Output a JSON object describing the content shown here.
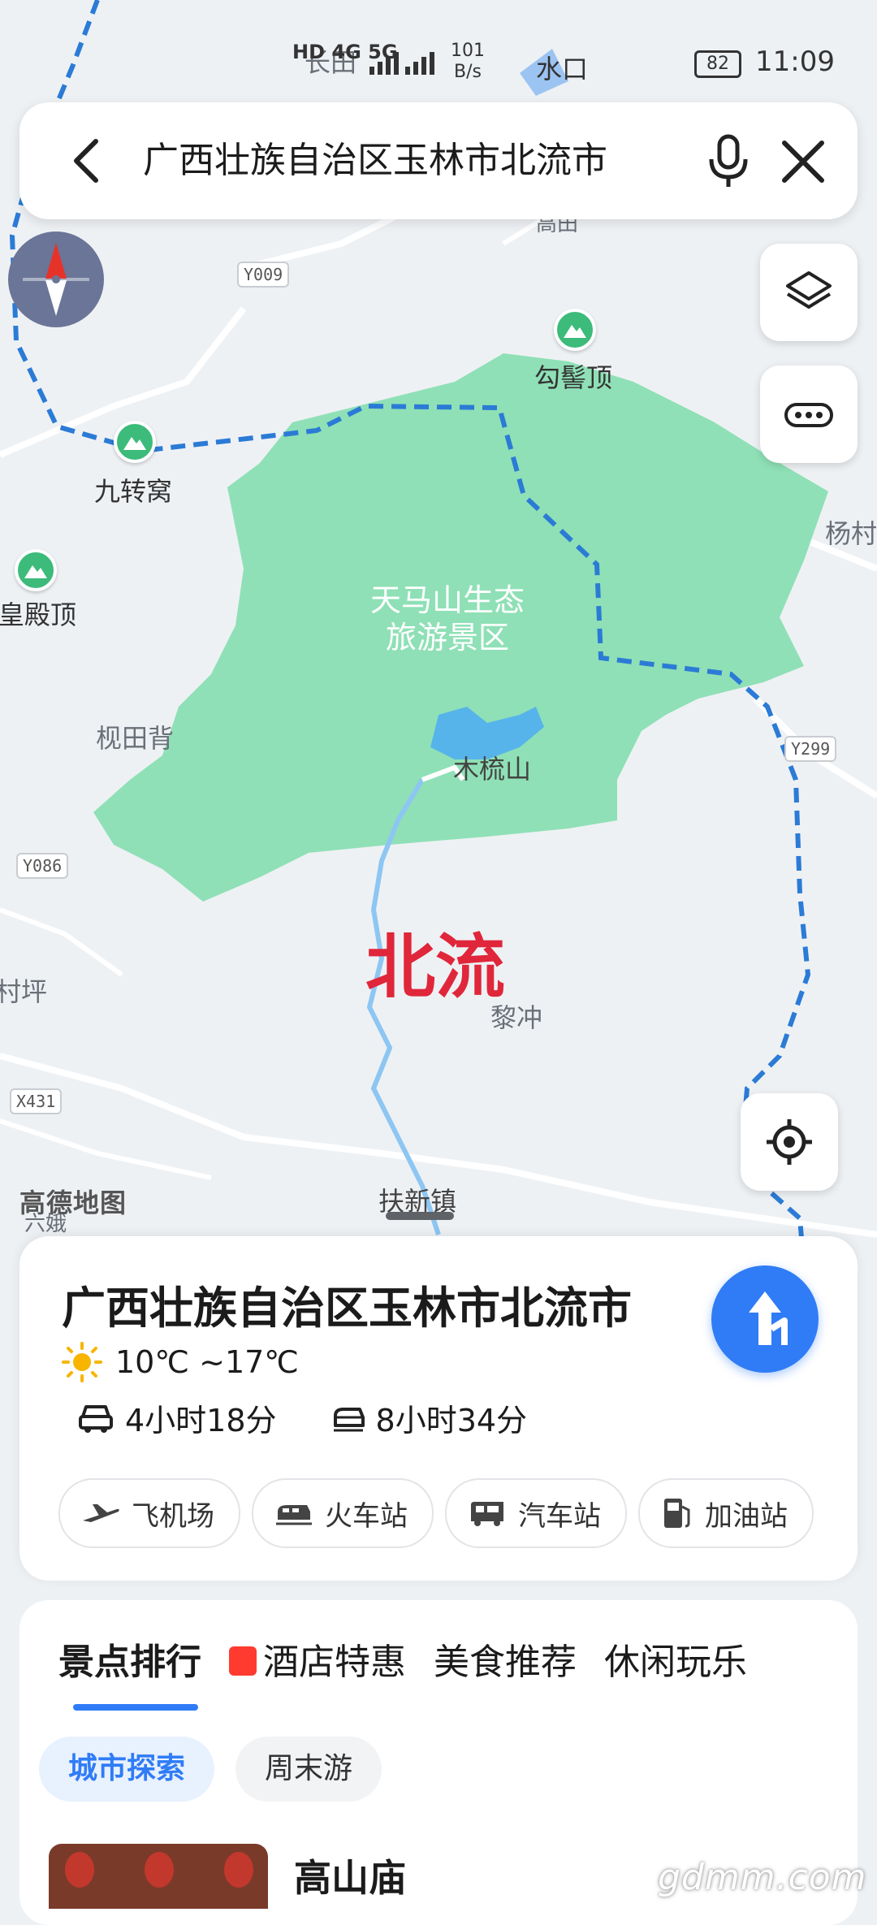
{
  "status_bar": {
    "network": "HD 4G 5G",
    "speed_value": "101",
    "speed_unit": "B/s",
    "battery": "82",
    "time": "11:09"
  },
  "search": {
    "query": "广西壮族自治区玉林市北流市"
  },
  "map": {
    "city_label": "北流",
    "scenic_area_line1": "天马山生态",
    "scenic_area_line2": "旅游景区",
    "labels": {
      "changtian": "长田",
      "shuikou": "水口",
      "gouji": "勾髻顶",
      "jiuzhuan": "九转窝",
      "yangcun": "杨村",
      "huangdian": "皇殿顶",
      "jiutianbei": "枧田背",
      "mushu": "木梳山",
      "cunping": "村坪",
      "lichong": "黎冲",
      "fuxin": "扶新镇",
      "liu_e": "六娥",
      "gaotian": "高田"
    },
    "roads": [
      "Y009",
      "Y299",
      "Y086",
      "X431"
    ],
    "credit": "高德地图",
    "colors": {
      "scenic_area": "#8fe0b6",
      "boundary": "#2b7bd6",
      "city_label": "#e0263a"
    }
  },
  "card": {
    "title": "广西壮族自治区玉林市北流市",
    "weather": "10℃ ~17℃",
    "drive_time": "4小时18分",
    "train_time": "8小时34分",
    "chips": [
      "飞机场",
      "火车站",
      "汽车站",
      "加油站"
    ]
  },
  "discover": {
    "tabs": [
      "景点排行",
      "酒店特惠",
      "美食推荐",
      "休闲玩乐"
    ],
    "subchips": [
      "城市探索",
      "周末游"
    ],
    "first_item_title": "高山庙"
  },
  "watermark": "gdmm.com"
}
